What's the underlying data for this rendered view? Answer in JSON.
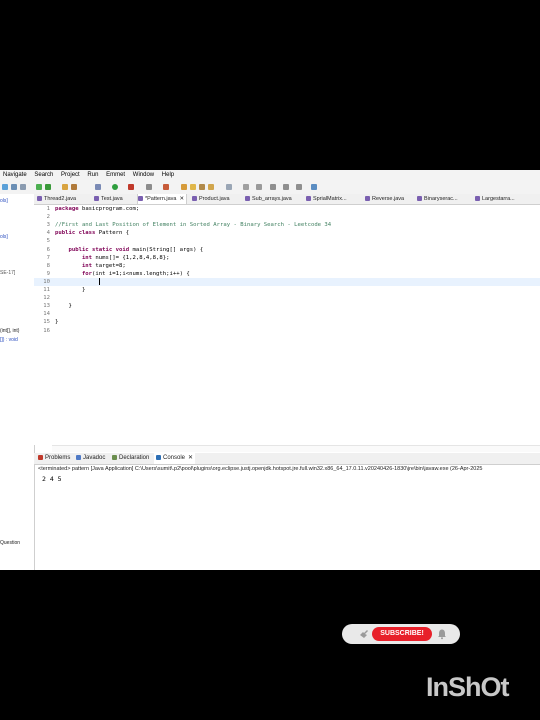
{
  "menu": [
    "Navigate",
    "Search",
    "Project",
    "Run",
    "Emmet",
    "Window",
    "Help"
  ],
  "left_panel": [
    "ols]",
    "ols]",
    "SE-17]",
    "(int[], int)",
    "[]) : void",
    "Question"
  ],
  "tabs": [
    "Thread2.java",
    "Test.java",
    "*Pattern.java",
    "Product.java",
    "Sub_arrays.java",
    "SprialMatrix...",
    "Reverse.java",
    "Binaryserac...",
    "Largestarra..."
  ],
  "editor": {
    "line_numbers": [
      "1",
      "2",
      "3",
      "4",
      "5",
      "6",
      "7",
      "8",
      "9",
      "10",
      "11",
      "12",
      "13",
      "14",
      "15",
      "16"
    ],
    "lines": [
      {
        "kw": "package",
        "text": " basicprogram.com;"
      },
      {
        "kw": "",
        "text": ""
      },
      {
        "kw": "",
        "text": "//First and Last Position of Element in Sorted Array - Binary Search - Leetcode 34"
      },
      {
        "kw": "public class",
        "text": " Pattern {"
      },
      {
        "kw": "",
        "text": ""
      },
      {
        "kw": "    public static void",
        "text": " main(String[] args) {"
      },
      {
        "kw": "        int",
        "text": " nums[]= {1,2,8,4,8,8};"
      },
      {
        "kw": "        int",
        "text": " target=8;"
      },
      {
        "kw": "        for",
        "text": "(int i=1;i<nums.length;i++) {"
      },
      {
        "kw": "",
        "text": ""
      },
      {
        "kw": "",
        "text": "        }"
      },
      {
        "kw": "",
        "text": ""
      },
      {
        "kw": "",
        "text": "    }"
      },
      {
        "kw": "",
        "text": ""
      },
      {
        "kw": "",
        "text": "}"
      },
      {
        "kw": "",
        "text": ""
      }
    ]
  },
  "console": {
    "tabs": [
      "Problems",
      "Javadoc",
      "Declaration",
      "Console"
    ],
    "terminated": "<terminated> pattern [Java Application] C:\\Users\\sumit\\.p2\\pool\\plugins\\org.eclipse.justj.openjdk.hotspot.jre.full.win32.x86_64_17.0.11.v20240426-1830\\jre\\bin\\javaw.exe  (26-Apr-2025",
    "output": "2 4 5"
  },
  "overlay": {
    "subscribe_label": "SUBSCRIBE!",
    "watermark": "InShOt"
  }
}
